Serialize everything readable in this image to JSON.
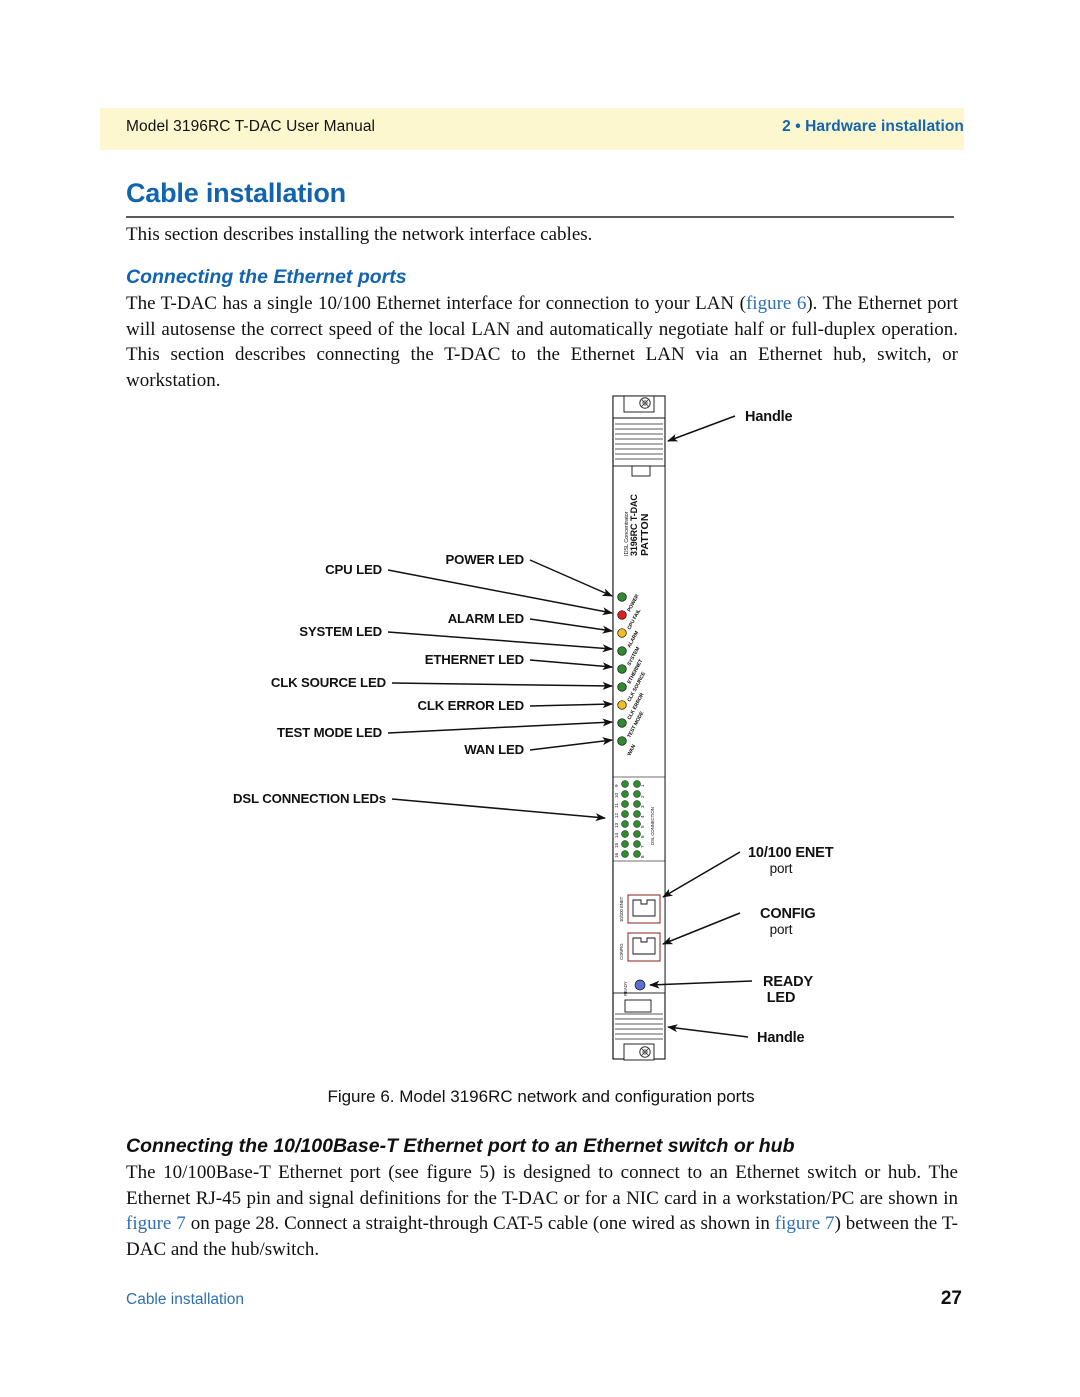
{
  "header": {
    "left": "Model 3196RC T-DAC User Manual",
    "right": "2 • Hardware installation",
    "band_color": "#fcf7cf",
    "accent_color": "#1264b0"
  },
  "section": {
    "title": "Cable installation",
    "intro": "This section describes installing the network interface cables.",
    "subtitle": "Connecting the Ethernet ports",
    "paragraph_pre": "The T-DAC has a single 10/100 Ethernet interface for connection to your LAN (",
    "paragraph_link1": "figure 6",
    "paragraph_post": "). The Ethernet port will autosense the correct speed of the local LAN and automatically negotiate half or full-duplex operation. This section describes connecting the T-DAC to the Ethernet LAN via an Ethernet hub, switch, or workstation."
  },
  "figure": {
    "caption": "Figure 6. Model 3196RC network and configuration ports",
    "device": {
      "brand": "PATTON",
      "model": "3196RC T-DAC",
      "subtitle": "IDSL Concentrator",
      "enet_port_label": "10/100 ENET",
      "config_port_label": "CONFIG",
      "ready_label": "READY",
      "dsl_group_label": "DSL CONNECTION"
    },
    "leds": [
      {
        "name": "POWER",
        "color": "#2e8b2e"
      },
      {
        "name": "CPU FAIL",
        "color": "#e02020"
      },
      {
        "name": "ALARM",
        "color": "#f0c020"
      },
      {
        "name": "SYSTEM",
        "color": "#2e8b2e"
      },
      {
        "name": "ETHERNET",
        "color": "#2e8b2e"
      },
      {
        "name": "CLK SOURCE",
        "color": "#2e8b2e"
      },
      {
        "name": "CLK ERROR",
        "color": "#f0c020"
      },
      {
        "name": "TEST MODE",
        "color": "#2e8b2e"
      },
      {
        "name": "WAN",
        "color": "#2e8b2e"
      }
    ],
    "dsl_numbers_right": [
      "1",
      "2",
      "3",
      "4",
      "5",
      "6",
      "7",
      "8"
    ],
    "dsl_numbers_left": [
      "9",
      "10",
      "11",
      "12",
      "13",
      "14",
      "15",
      "16"
    ],
    "dsl_led_color": "#2e8b2e",
    "ready_led_color": "#5c6fd0",
    "callouts_left": [
      "CPU LED",
      "SYSTEM LED",
      "CLK SOURCE LED",
      "TEST MODE LED",
      "DSL CONNECTION LEDs"
    ],
    "callouts_mid": [
      "POWER LED",
      "ALARM LED",
      "ETHERNET LED",
      "CLK ERROR LED",
      "WAN LED"
    ],
    "callouts_right": [
      {
        "line1": "Handle",
        "line2": ""
      },
      {
        "line1": "10/100 ENET",
        "line2": "port"
      },
      {
        "line1": "CONFIG",
        "line2": "port"
      },
      {
        "line1": "READY",
        "line2": "LED"
      },
      {
        "line1": "Handle",
        "line2": ""
      }
    ]
  },
  "section2": {
    "subtitle": "Connecting the 10/100Base-T Ethernet port to an Ethernet switch or hub",
    "p_a": "The 10/100Base-T Ethernet port (see figure 5) is designed to connect to an Ethernet switch or hub. The Ethernet RJ-45 pin and signal definitions for the T-DAC or for a NIC card in a workstation/PC are shown in ",
    "link_a": "figure 7",
    "p_b": " on page 28. Connect a straight-through CAT-5 cable (one wired as shown in ",
    "link_b": "figure 7",
    "p_c": ") between the T-DAC and the hub/switch."
  },
  "footer": {
    "left": "Cable installation",
    "page": "27"
  }
}
